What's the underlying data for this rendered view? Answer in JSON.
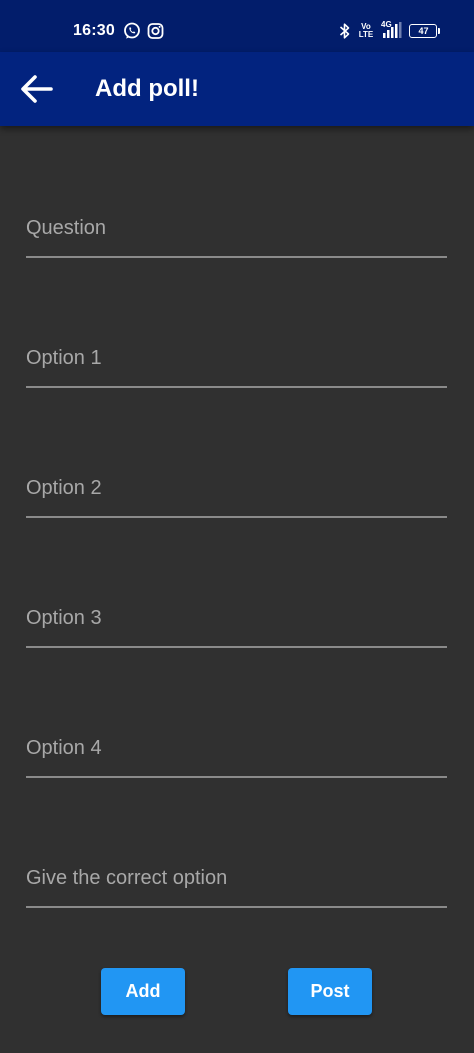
{
  "status_bar": {
    "time": "16:30",
    "icons_left": [
      "whatsapp-icon",
      "instagram-icon"
    ],
    "icons_right": [
      "bluetooth-icon",
      "volte-icon",
      "4g-signal-icon",
      "battery-icon"
    ],
    "volte_label_top": "Vo",
    "volte_label_bottom": "LTE",
    "network_label": "4G",
    "battery_level": "47"
  },
  "app_bar": {
    "title": "Add poll!",
    "back_icon": "arrow-back-icon"
  },
  "form": {
    "question_placeholder": "Question",
    "option1_placeholder": "Option 1",
    "option2_placeholder": "Option 2",
    "option3_placeholder": "Option 3",
    "option4_placeholder": "Option 4",
    "correct_option_placeholder": "Give the correct option"
  },
  "actions": {
    "add_label": "Add",
    "post_label": "Post"
  },
  "colors": {
    "status_bar": "#021d6b",
    "app_bar": "#02237f",
    "background": "#303030",
    "button": "#2196f3",
    "underline": "#8a8a8a"
  }
}
